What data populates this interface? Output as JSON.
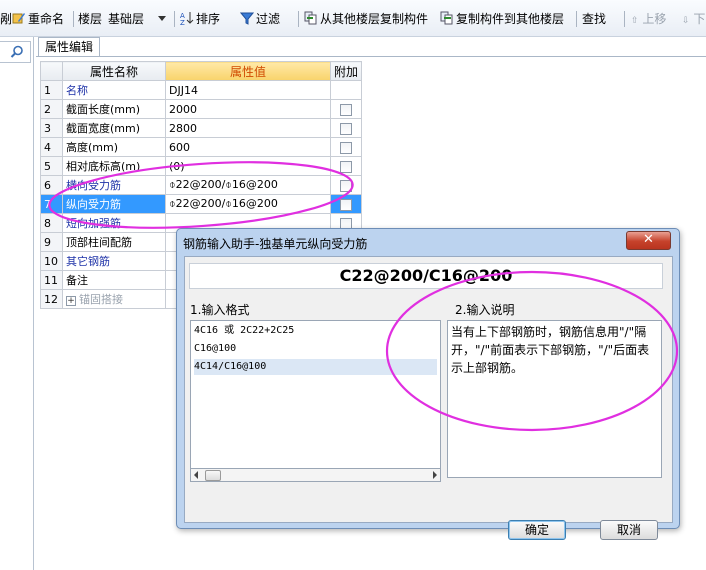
{
  "toolbar": {
    "partial_left": "剐",
    "rename": "重命名",
    "floor_label": "楼层",
    "floor_value": "基础层",
    "sort": "排序",
    "filter": "过滤",
    "copy_from_other": "从其他楼层复制构件",
    "copy_to_other": "复制构件到其他楼层",
    "find": "查找",
    "move_up": "上移",
    "move_down_partial": "下"
  },
  "tab": {
    "label": "属性编辑"
  },
  "table": {
    "headers": [
      "",
      "属性名称",
      "属性值",
      "附加"
    ],
    "rows": [
      {
        "num": "1",
        "name": "名称",
        "value": "DJJ14",
        "blue": true,
        "checkbox": false
      },
      {
        "num": "2",
        "name": "截面长度(mm)",
        "value": "2000",
        "blue": false,
        "checkbox": true
      },
      {
        "num": "3",
        "name": "截面宽度(mm)",
        "value": "2800",
        "blue": false,
        "checkbox": true
      },
      {
        "num": "4",
        "name": "高度(mm)",
        "value": "600",
        "blue": false,
        "checkbox": true
      },
      {
        "num": "5",
        "name": "相对底标高(m)",
        "value": "(0)",
        "blue": false,
        "checkbox": true
      },
      {
        "num": "6",
        "name": "横向受力筋",
        "value": "⌽22@200/⌽16@200",
        "blue": true,
        "checkbox": true
      },
      {
        "num": "7",
        "name": "纵向受力筋",
        "value": "⌽22@200/⌽16@200",
        "blue": true,
        "checkbox": true,
        "selected": true
      },
      {
        "num": "8",
        "name": "短向加强筋",
        "value": "",
        "blue": true,
        "checkbox": true
      },
      {
        "num": "9",
        "name": "顶部柱间配筋",
        "value": "",
        "blue": false,
        "checkbox": false
      },
      {
        "num": "10",
        "name": "其它钢筋",
        "value": "",
        "blue": true,
        "checkbox": false
      },
      {
        "num": "11",
        "name": "备注",
        "value": "",
        "blue": false,
        "checkbox": false
      },
      {
        "num": "12",
        "name": "锚固搭接",
        "value": "",
        "blue": false,
        "checkbox": false,
        "expander": true,
        "dim": true
      }
    ]
  },
  "dialog": {
    "title": "钢筋输入助手-独基单元纵向受力筋",
    "close": "✕",
    "formula": "C22@200/C16@200",
    "format_label": "1.输入格式",
    "desc_label": "2.输入说明",
    "formats": [
      "4C16 或 2C22+2C25",
      "C16@100",
      "4C14/C16@100"
    ],
    "description": "当有上下部钢筋时，钢筋信息用\"/\"隔开，\"/\"前面表示下部钢筋，\"/\"后面表示上部钢筋。",
    "ok": "确定",
    "cancel": "取消"
  },
  "colors": {
    "annotation": "#e02fe0",
    "selection": "#3399ff",
    "value_header": "#d04a00"
  }
}
